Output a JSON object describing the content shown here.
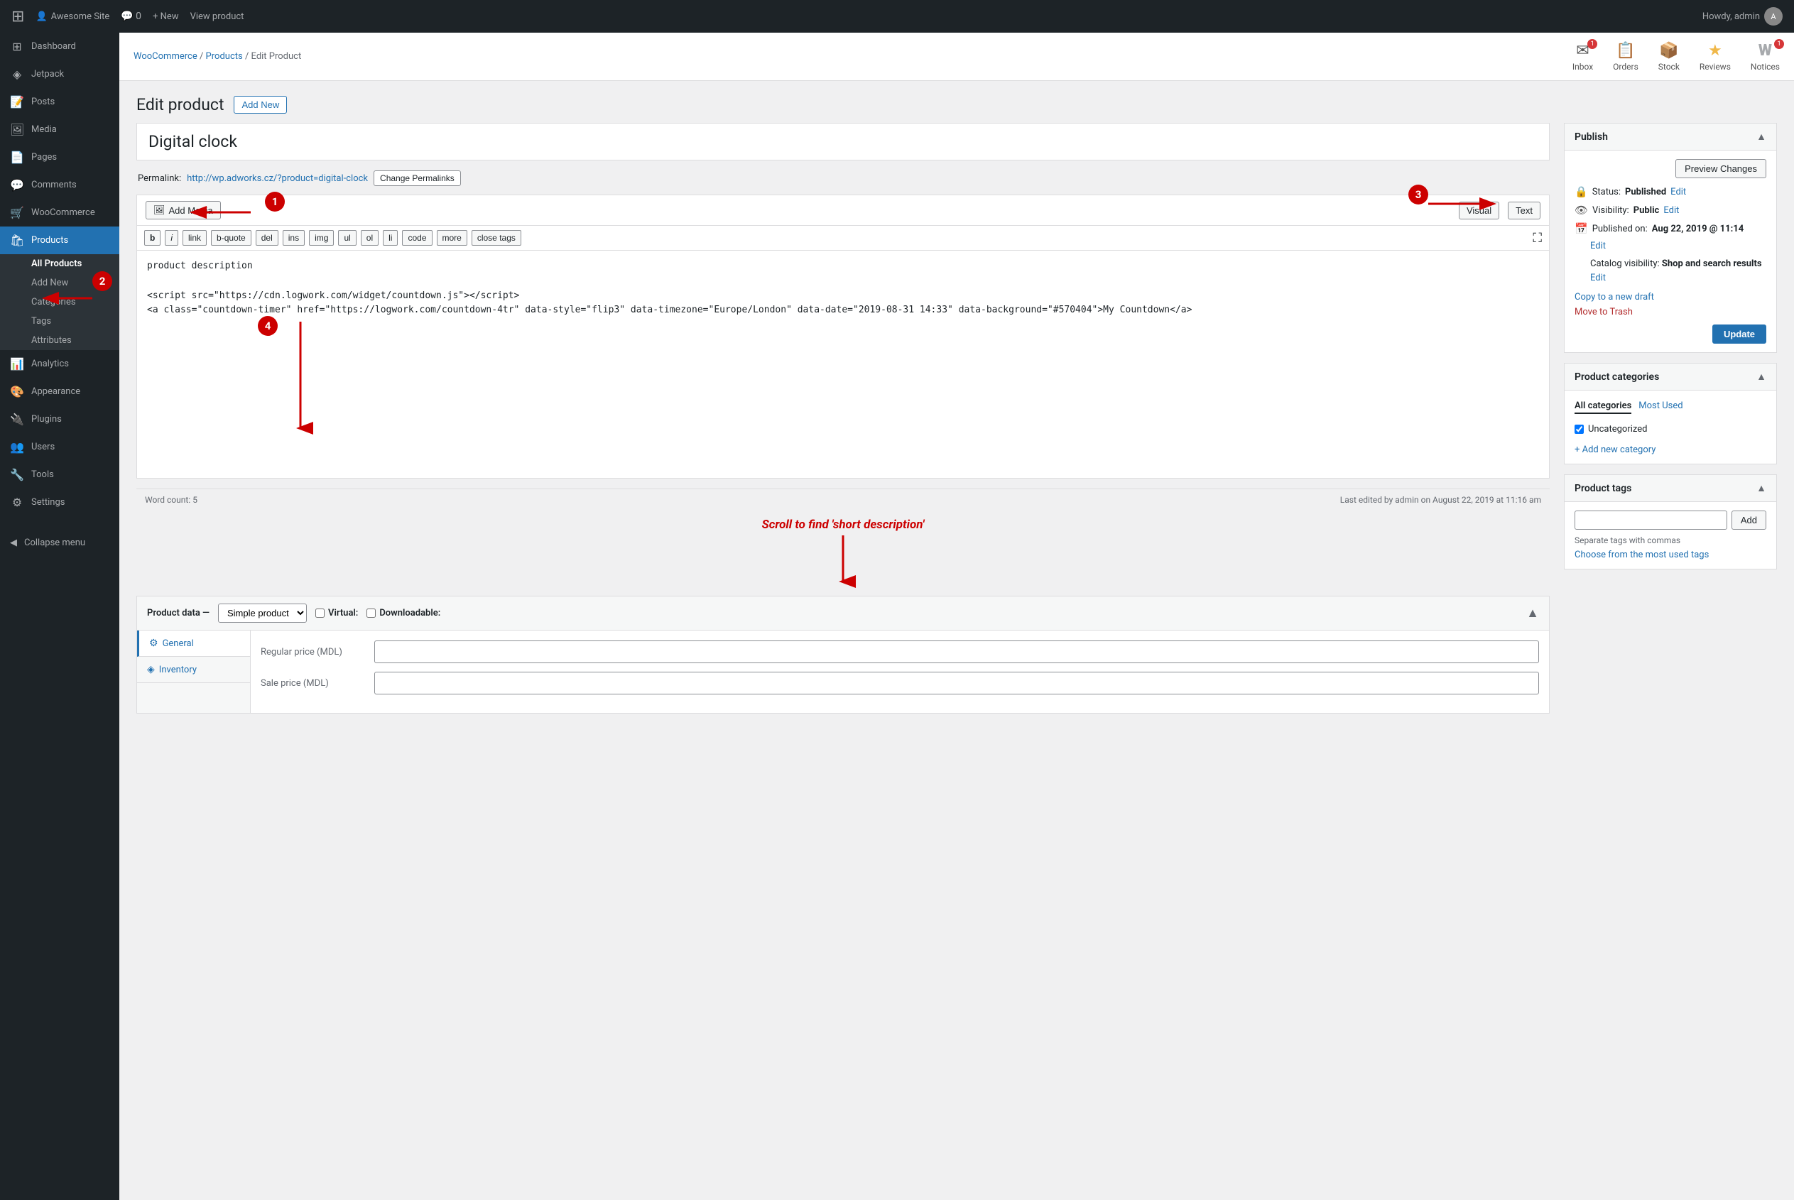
{
  "adminbar": {
    "wp_logo": "⊞",
    "site_name": "Awesome Site",
    "site_icon": "👤",
    "new_label": "+ New",
    "view_product": "View product",
    "howdy": "Howdy, admin"
  },
  "breadcrumb": {
    "woocommerce": "WooCommerce",
    "separator": "/",
    "products": "Products",
    "separator2": "/",
    "current": "Edit Product"
  },
  "top_icons": [
    {
      "id": "inbox",
      "glyph": "✉",
      "label": "Inbox",
      "badge": "1"
    },
    {
      "id": "orders",
      "glyph": "📋",
      "label": "Orders",
      "badge": null
    },
    {
      "id": "stock",
      "glyph": "📦",
      "label": "Stock",
      "badge": null
    },
    {
      "id": "reviews",
      "glyph": "★",
      "label": "Reviews",
      "badge": null
    },
    {
      "id": "notices",
      "glyph": "W",
      "label": "Notices",
      "badge": "1"
    }
  ],
  "sidebar": {
    "items": [
      {
        "id": "dashboard",
        "icon": "⊞",
        "label": "Dashboard"
      },
      {
        "id": "jetpack",
        "icon": "◈",
        "label": "Jetpack"
      },
      {
        "id": "posts",
        "icon": "📝",
        "label": "Posts"
      },
      {
        "id": "media",
        "icon": "🖼",
        "label": "Media"
      },
      {
        "id": "pages",
        "icon": "📄",
        "label": "Pages"
      },
      {
        "id": "comments",
        "icon": "💬",
        "label": "Comments"
      },
      {
        "id": "woocommerce",
        "icon": "🛒",
        "label": "WooCommerce"
      },
      {
        "id": "products",
        "icon": "🛍",
        "label": "Products"
      }
    ],
    "submenu": [
      {
        "id": "all-products",
        "label": "All Products",
        "active": true
      },
      {
        "id": "add-new",
        "label": "Add New"
      },
      {
        "id": "categories",
        "label": "Categories"
      },
      {
        "id": "tags",
        "label": "Tags"
      },
      {
        "id": "attributes",
        "label": "Attributes"
      }
    ],
    "bottom_items": [
      {
        "id": "analytics",
        "icon": "📊",
        "label": "Analytics"
      },
      {
        "id": "appearance",
        "icon": "🎨",
        "label": "Appearance"
      },
      {
        "id": "plugins",
        "icon": "🔌",
        "label": "Plugins"
      },
      {
        "id": "users",
        "icon": "👥",
        "label": "Users"
      },
      {
        "id": "tools",
        "icon": "🔧",
        "label": "Tools"
      },
      {
        "id": "settings",
        "icon": "⚙",
        "label": "Settings"
      }
    ],
    "collapse_label": "Collapse menu"
  },
  "page": {
    "title": "Edit product",
    "add_new_label": "Add New"
  },
  "product": {
    "title": "Digital clock",
    "permalink_label": "Permalink:",
    "permalink_url": "http://wp.adworks.cz/?product=digital-clock",
    "change_permalinks": "Change Permalinks"
  },
  "editor": {
    "add_media": "Add Media",
    "view_label": "Visual",
    "text_label": "Text",
    "format_buttons": [
      "b",
      "i",
      "link",
      "b-quote",
      "del",
      "ins",
      "img",
      "ul",
      "ol",
      "li",
      "code",
      "more",
      "close tags"
    ],
    "content": "product description\n\n<script src=\"https://cdn.logwork.com/widget/countdown.js\"></script>\n<a class=\"countdown-timer\" href=\"https://logwork.com/countdown-4tr\" data-style=\"flip3\" data-timezone=\"Europe/London\" data-date=\"2019-08-31 14:33\" data-background=\"#570404\">My Countdown</a>",
    "word_count_label": "Word count:",
    "word_count": "5",
    "last_edited": "Last edited by admin on August 22, 2019 at 11:16 am"
  },
  "product_data": {
    "label": "Product data —",
    "type": "Simple product",
    "virtual_label": "Virtual:",
    "downloadable_label": "Downloadable:",
    "tabs": [
      {
        "id": "general",
        "icon": "⚙",
        "label": "General",
        "active": true
      },
      {
        "id": "inventory",
        "icon": "◈",
        "label": "Inventory"
      }
    ],
    "fields": [
      {
        "id": "regular-price",
        "label": "Regular price (MDL)"
      },
      {
        "id": "sale-price",
        "label": "Sale price (MDL)"
      }
    ]
  },
  "publish_panel": {
    "title": "Publish",
    "preview_changes": "Preview Changes",
    "status_label": "Status:",
    "status_value": "Published",
    "status_edit": "Edit",
    "visibility_label": "Visibility:",
    "visibility_value": "Public",
    "visibility_edit": "Edit",
    "published_label": "Published on:",
    "published_value": "Aug 22, 2019 @ 11:14",
    "published_edit": "Edit",
    "catalog_label": "Catalog visibility:",
    "catalog_value": "Shop and search results",
    "catalog_edit": "Edit",
    "copy_draft": "Copy to a new draft",
    "move_trash": "Move to Trash",
    "update_label": "Update"
  },
  "categories_panel": {
    "title": "Product categories",
    "all_cats_tab": "All categories",
    "most_used_tab": "Most Used",
    "categories": [
      {
        "id": "uncategorized",
        "label": "Uncategorized",
        "checked": true
      }
    ],
    "add_new": "+ Add new category"
  },
  "tags_panel": {
    "title": "Product tags",
    "add_btn": "Add",
    "note": "Separate tags with commas",
    "choose_link": "Choose from the most used tags"
  },
  "annotations": {
    "num1": "1",
    "num2": "2",
    "num3": "3",
    "num4": "4",
    "scroll_note": "Scroll to find 'short description'"
  }
}
